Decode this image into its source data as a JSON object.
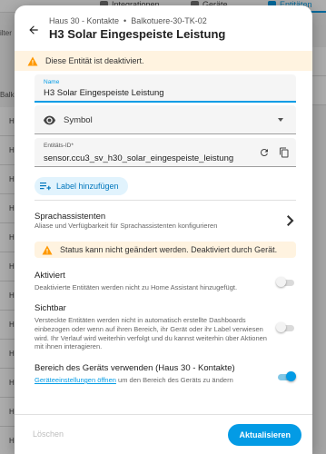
{
  "background": {
    "tabs": [
      {
        "label": "Integrationen"
      },
      {
        "label": "Geräte"
      },
      {
        "label": "Entitäten"
      }
    ],
    "left_labels": [
      "ilter",
      "Balko"
    ],
    "row_letter": "H"
  },
  "dialog": {
    "breadcrumb": {
      "area": "Haus 30 - Kontakte",
      "separator": "•",
      "device": "Balkotuere-30-TK-02"
    },
    "title": "H3 Solar Eingespeiste Leistung",
    "disabled_warning": "Diese Entität ist deaktiviert.",
    "name_field": {
      "label": "Name",
      "value": "H3 Solar Eingespeiste Leistung"
    },
    "icon_field": {
      "placeholder": "Symbol"
    },
    "entity_id_field": {
      "label": "Entitäts-ID*",
      "value": "sensor.ccu3_sv_h30_solar_eingespeiste_leistung"
    },
    "add_label_button": "Label hinzufügen",
    "voice_assistants": {
      "title": "Sprachassistenten",
      "subtitle": "Aliase und Verfügbarkeit für Sprachassistenten konfigurieren"
    },
    "status_warning": "Status kann nicht geändert werden. Deaktiviert durch Gerät.",
    "enabled": {
      "title": "Aktiviert",
      "subtitle": "Deaktivierte Entitäten werden nicht zu Home Assistant hinzugefügt.",
      "state": "off"
    },
    "visible": {
      "title": "Sichtbar",
      "subtitle": "Versteckte Entitäten werden nicht in automatisch erstellte Dashboards einbezogen oder wenn auf ihren Bereich, ihr Gerät oder ihr Label verwiesen wird. Ihr Verlauf wird weiterhin verfolgt und du kannst weiterhin über Aktionen mit ihnen interagieren.",
      "state": "off"
    },
    "use_device_area": {
      "title": "Bereich des Geräts verwenden (Haus 30 - Kontakte)",
      "link_text": "Geräteeinstellungen öffnen",
      "subtitle_rest": " um den Bereich des Geräts zu ändern",
      "state": "on"
    },
    "footer": {
      "delete_label": "Löschen",
      "update_label": "Aktualisieren"
    }
  },
  "colors": {
    "accent": "#039be5",
    "warning": "#ff9800",
    "warning_bg": "#fff3e0"
  }
}
